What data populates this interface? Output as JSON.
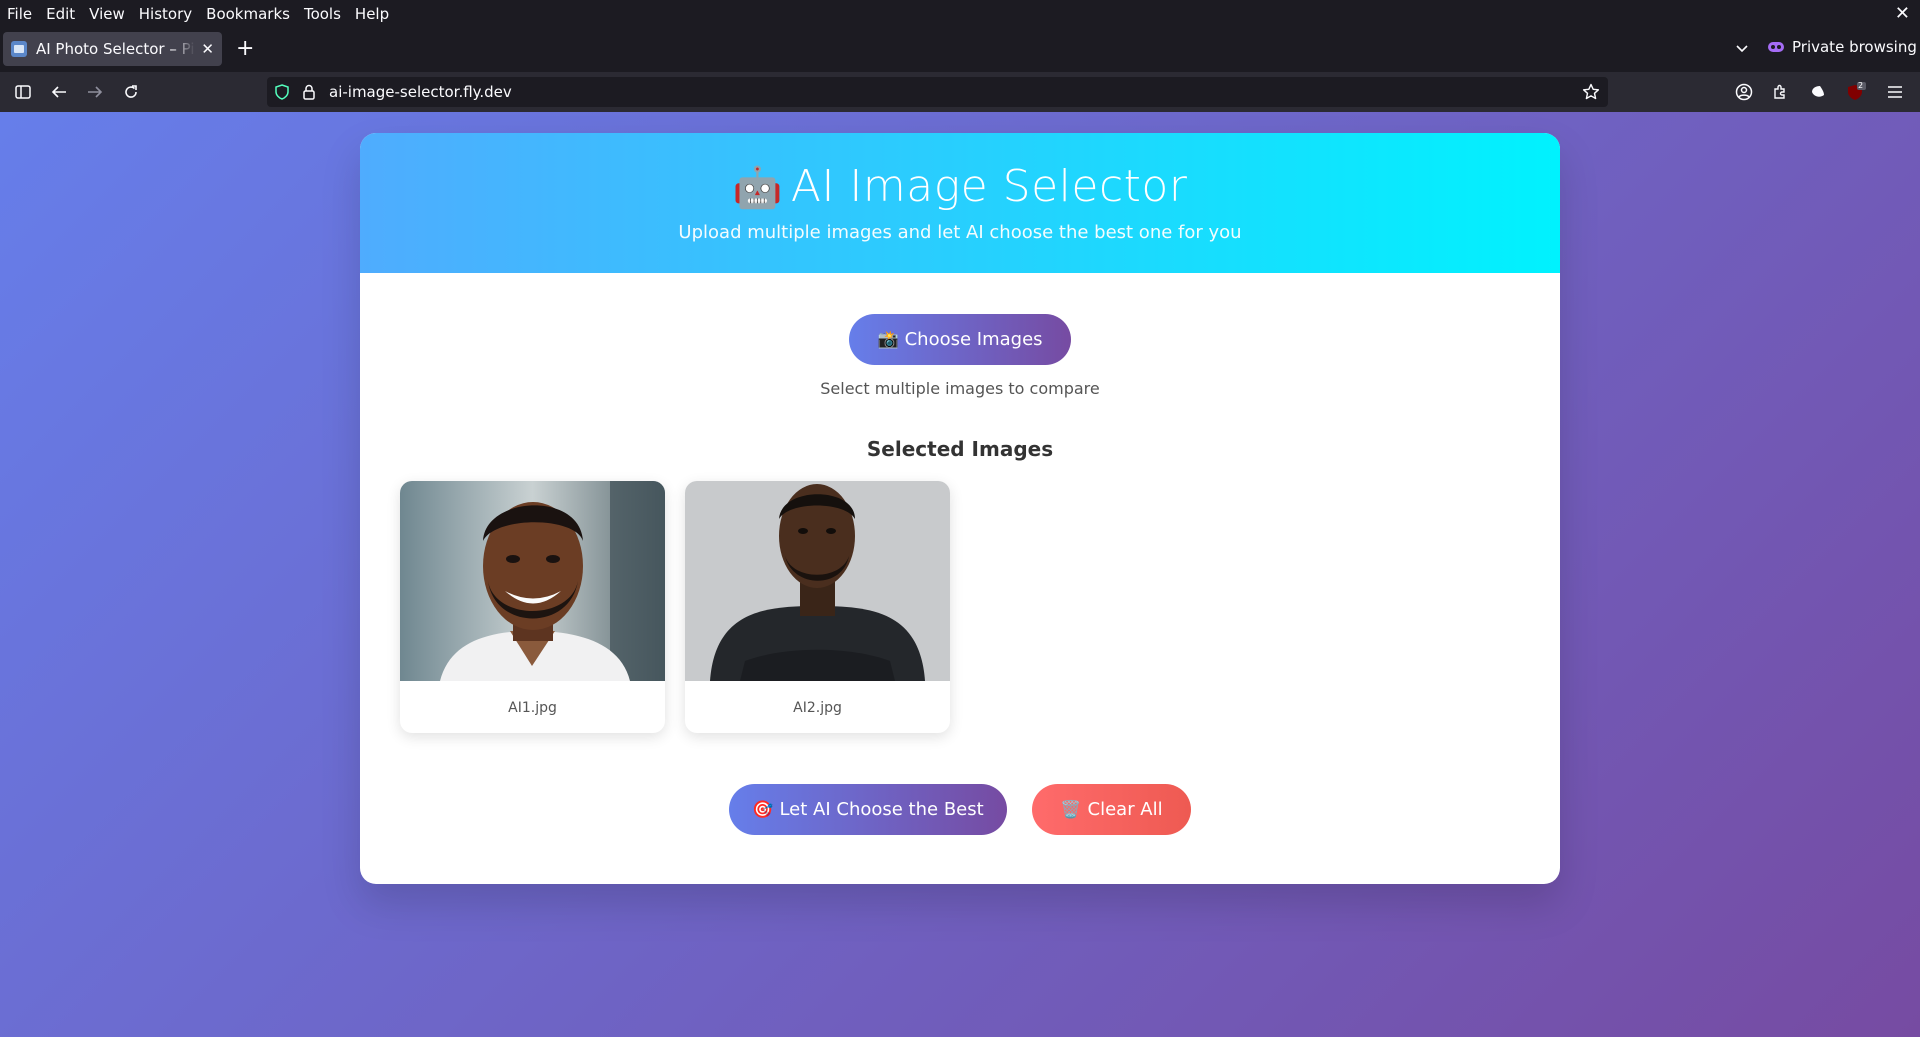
{
  "menubar": {
    "items": [
      "File",
      "Edit",
      "View",
      "History",
      "Bookmarks",
      "Tools",
      "Help"
    ],
    "close_glyph": "✕"
  },
  "tabs": {
    "active_title": "AI Photo Selector – Pick the Best",
    "close_glyph": "✕",
    "new_tab_glyph": "+",
    "private_label": "Private browsing"
  },
  "navbar": {
    "url": "ai-image-selector.fly.dev",
    "extension_badge": "2"
  },
  "page": {
    "title_emoji": "🤖",
    "title": "AI Image Selector",
    "subtitle": "Upload multiple images and let AI choose the best one for you",
    "choose_emoji": "📸",
    "choose_label": "Choose Images",
    "choose_hint": "Select multiple images to compare",
    "selected_heading": "Selected Images",
    "images": [
      {
        "filename": "AI1.jpg"
      },
      {
        "filename": "AI2.jpg"
      }
    ],
    "ai_emoji": "🎯",
    "ai_label": "Let AI Choose the Best",
    "clear_emoji": "🗑️",
    "clear_label": "Clear All"
  },
  "colors": {
    "header_gradient": [
      "#4facfe",
      "#00f2fe"
    ],
    "primary_gradient": [
      "#667eea",
      "#764ba2"
    ],
    "danger_gradient": [
      "#ff6b6b",
      "#ee5a52"
    ]
  }
}
